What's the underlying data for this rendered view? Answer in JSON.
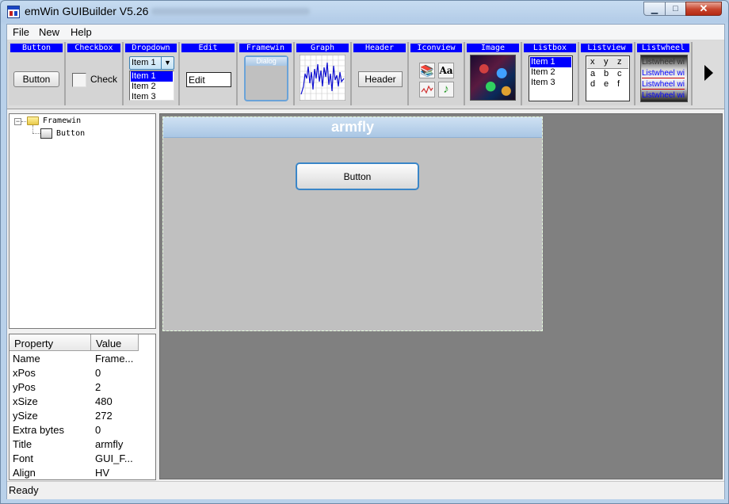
{
  "window": {
    "title": "emWin GUIBuilder V5.26"
  },
  "menu": [
    "File",
    "New",
    "Help"
  ],
  "toolbar": {
    "labels": {
      "button": "Button",
      "checkbox": "Checkbox",
      "dropdown": "Dropdown",
      "edit": "Edit",
      "framewin": "Framewin",
      "graph": "Graph",
      "header": "Header",
      "iconview": "Iconview",
      "image": "Image",
      "listbox": "Listbox",
      "listview": "Listview",
      "listwheel": "Listwheel"
    },
    "button_sample": "Button",
    "checkbox_sample": "Check",
    "dropdown_selected": "Item 1",
    "dropdown_items": [
      "Item 1",
      "Item 2",
      "Item 3"
    ],
    "edit_sample": "Edit",
    "framewin_sample": "Dialog",
    "header_sample": "Header",
    "iconview_text_icon": "Aa",
    "listbox_items": [
      "Item 1",
      "Item 2",
      "Item 3"
    ],
    "listview_cells": [
      [
        "x",
        "y",
        "z"
      ],
      [
        "a",
        "b",
        "c"
      ],
      [
        "d",
        "e",
        "f"
      ]
    ],
    "listwheel_items": [
      "Listwheel wi",
      "Listwheel wi",
      "Listwheel wi",
      "Listwheel wi"
    ]
  },
  "tree": {
    "root": "Framewin",
    "child": "Button"
  },
  "properties": {
    "header_property": "Property",
    "header_value": "Value",
    "rows": [
      {
        "name": "Name",
        "value": "Frame..."
      },
      {
        "name": "xPos",
        "value": "0"
      },
      {
        "name": "yPos",
        "value": "2"
      },
      {
        "name": "xSize",
        "value": "480"
      },
      {
        "name": "ySize",
        "value": "272"
      },
      {
        "name": "Extra bytes",
        "value": "0"
      },
      {
        "name": "Title",
        "value": "armfly"
      },
      {
        "name": "Font",
        "value": "GUI_F..."
      },
      {
        "name": "Align",
        "value": "HV"
      }
    ]
  },
  "design": {
    "frame_title": "armfly",
    "button_text": "Button"
  },
  "status": "Ready"
}
